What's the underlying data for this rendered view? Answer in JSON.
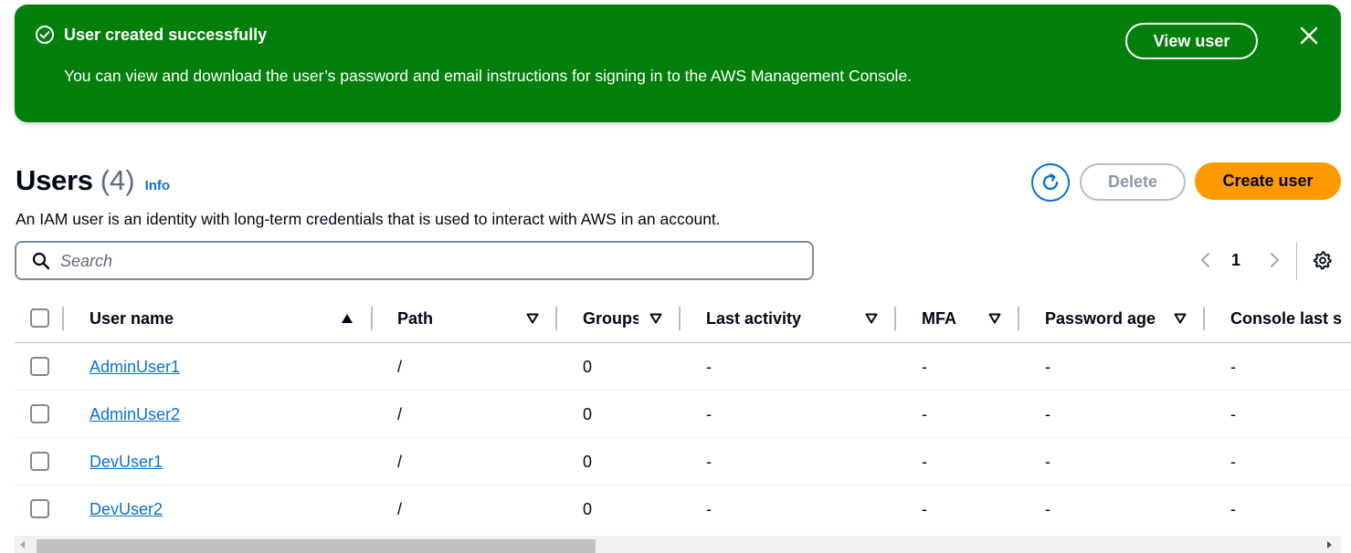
{
  "flash": {
    "title": "User created successfully",
    "message": "You can view and download the user’s password and email instructions for signing in to the AWS Management Console.",
    "view_user_label": "View user",
    "icon": "success-check-icon",
    "close_icon": "close-icon",
    "color": "#037f0c"
  },
  "header": {
    "title": "Users",
    "count": "(4)",
    "info_label": "Info",
    "description": "An IAM user is an identity with long-term credentials that is used to interact with AWS in an account.",
    "delete_label": "Delete",
    "create_label": "Create user",
    "refresh_icon": "refresh-icon",
    "primary_color": "#ff9900",
    "link_color": "#0972d3"
  },
  "search": {
    "placeholder": "Search",
    "value": ""
  },
  "pagination": {
    "current_page": "1"
  },
  "table": {
    "columns": [
      "User name",
      "Path",
      "Groups",
      "Last activity",
      "MFA",
      "Password age",
      "Console last s"
    ],
    "rows": [
      {
        "user_name": "AdminUser1",
        "path": "/",
        "groups": "0",
        "last_activity": "-",
        "mfa": "-",
        "password_age": "-",
        "console_last": "-"
      },
      {
        "user_name": "AdminUser2",
        "path": "/",
        "groups": "0",
        "last_activity": "-",
        "mfa": "-",
        "password_age": "-",
        "console_last": "-"
      },
      {
        "user_name": "DevUser1",
        "path": "/",
        "groups": "0",
        "last_activity": "-",
        "mfa": "-",
        "password_age": "-",
        "console_last": "-"
      },
      {
        "user_name": "DevUser2",
        "path": "/",
        "groups": "0",
        "last_activity": "-",
        "mfa": "-",
        "password_age": "-",
        "console_last": "-"
      }
    ]
  }
}
